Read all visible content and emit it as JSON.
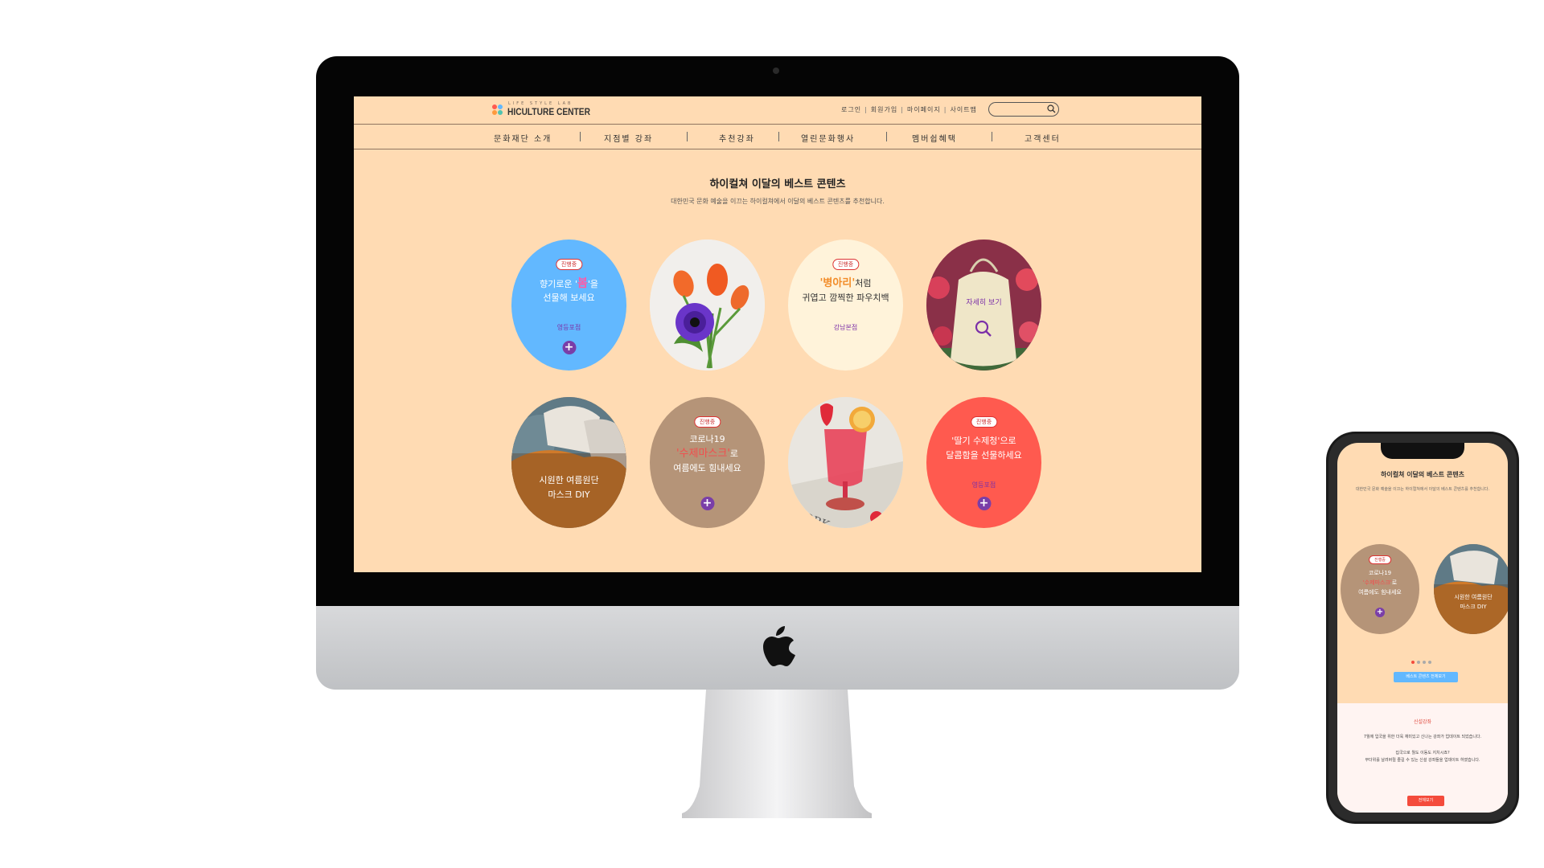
{
  "header": {
    "logo_sub": "LIFE STYLE LAB",
    "logo_main": "HICULTURE CENTER",
    "util_links": [
      "로그인",
      "회원가입",
      "마이페이지",
      "사이트맵"
    ]
  },
  "nav": [
    "문화재단 소개",
    "지점별 강좌",
    "추천강좌",
    "열린문화행사",
    "멤버쉽혜택",
    "고객센터"
  ],
  "section": {
    "title": "하이컬쳐 이달의 베스트 콘텐츠",
    "subtitle": "대한민국 문화 예술을 이끄는 하이컬쳐에서 이달의 베스트 콘텐츠를 추천합니다."
  },
  "cards": {
    "c1": {
      "badge": "진행중",
      "line1_pre": "향기로운 '",
      "line1_hl": "봄",
      "line1_post": "'을",
      "line2": "선물해 보세요",
      "branch": "영등포점"
    },
    "c3": {
      "badge": "진행중",
      "line1_hl": "'병아리'",
      "line1_post": "처럼",
      "line2": "귀엽고 깜찍한 파우치백",
      "branch": "강남본점"
    },
    "c4": {
      "text": "자세히 보기"
    },
    "c5": {
      "line1": "시원한 여름원단",
      "line2": "마스크 DIY"
    },
    "c6": {
      "badge": "진행중",
      "line1": "코로나19",
      "line2_hl": "'수제마스크'",
      "line2_post": "로",
      "line3": "여름에도 힘내세요"
    },
    "c8": {
      "badge": "진행중",
      "line1": "'딸기 수제청'으로",
      "line2": "달콤함을 선물하세요",
      "branch": "영등포점"
    }
  },
  "phone": {
    "title": "하이컬쳐 이달의 베스트 콘텐츠",
    "subtitle": "대한민국 문화 예술을 이끄는 하이컬쳐에서 이달의 베스트 콘텐츠를 추천합니다.",
    "card_a": {
      "badge": "진행중",
      "line1": "코로나19",
      "line2_hl": "'수제마스크'",
      "line2_post": "로",
      "line3": "여름에도 힘내세요"
    },
    "card_b": {
      "line1": "시원한 여름원단",
      "line2": "마스크 DIY"
    },
    "all_button": "베스트 콘텐츠 전체보기",
    "new_title": "신설강좌",
    "new_line1": "7월에 입국을 위한 더욱 재미있고 신나는 강좌가 업데이트 되었습니다.",
    "new_line2": "집국으로 뭘도 이동도 지치시죠?",
    "new_line3": "무더위를 날려버릴 즐길 수 있는 신설 강좌들을 업데이트 하였습니다.",
    "new_button": "전체보기"
  },
  "colors": {
    "screen_bg": "#ffdbb3",
    "card_blue": "#62b8ff",
    "card_cream": "#fff3da",
    "card_brown": "#b59478",
    "card_red": "#ff5a4f",
    "accent_purple": "#7a3ea8"
  }
}
